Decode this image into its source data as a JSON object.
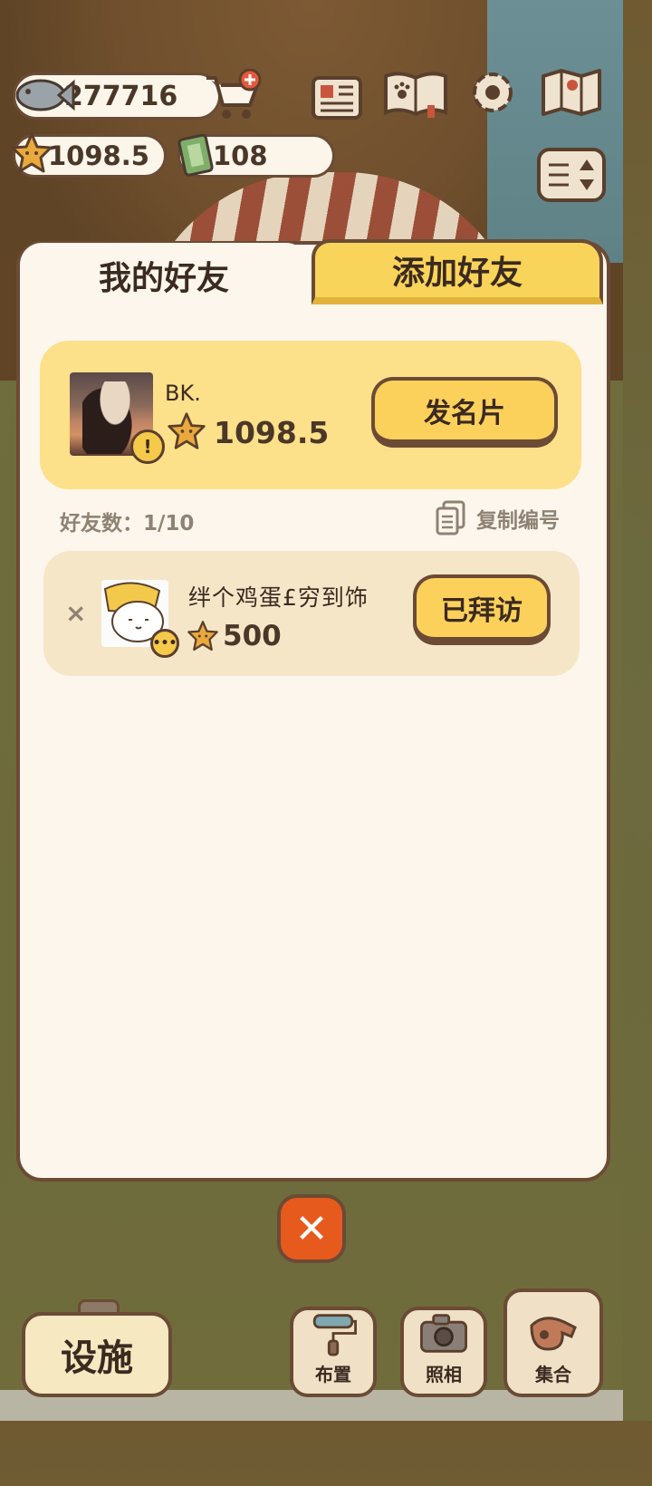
{
  "currency": {
    "fish": "277716",
    "stars": "1098.5",
    "tickets": "108"
  },
  "tabs": {
    "my_friends": "我的好友",
    "add_friend": "添加好友"
  },
  "me": {
    "name": "BK.",
    "score": "1098.5",
    "send_card_label": "发名片"
  },
  "friends_meta": {
    "count_label": "好友数：1/10",
    "copy_id_label": "复制编号"
  },
  "friends": [
    {
      "name": "绊个鸡蛋£穷到饰",
      "score": "500",
      "action_label": "已拜访",
      "remove_symbol": "×"
    }
  ],
  "close_symbol": "✕",
  "bottom_bar": {
    "facility_label": "设施",
    "arrange_label": "布置",
    "photo_label": "照相",
    "gather_label": "集合"
  },
  "icons": {
    "fish": "fish-icon",
    "cart": "shop-cart-icon",
    "star": "star-icon",
    "ticket": "ticket-icon",
    "news": "newspaper-icon",
    "book": "paw-book-icon",
    "gear": "gear-icon",
    "map": "map-icon",
    "sort": "sort-icon"
  },
  "colors": {
    "accent_yellow": "#fcd15b",
    "panel_bg": "#fdf6ec",
    "border_brown": "#6b4b35",
    "close_orange": "#e65a1e"
  }
}
